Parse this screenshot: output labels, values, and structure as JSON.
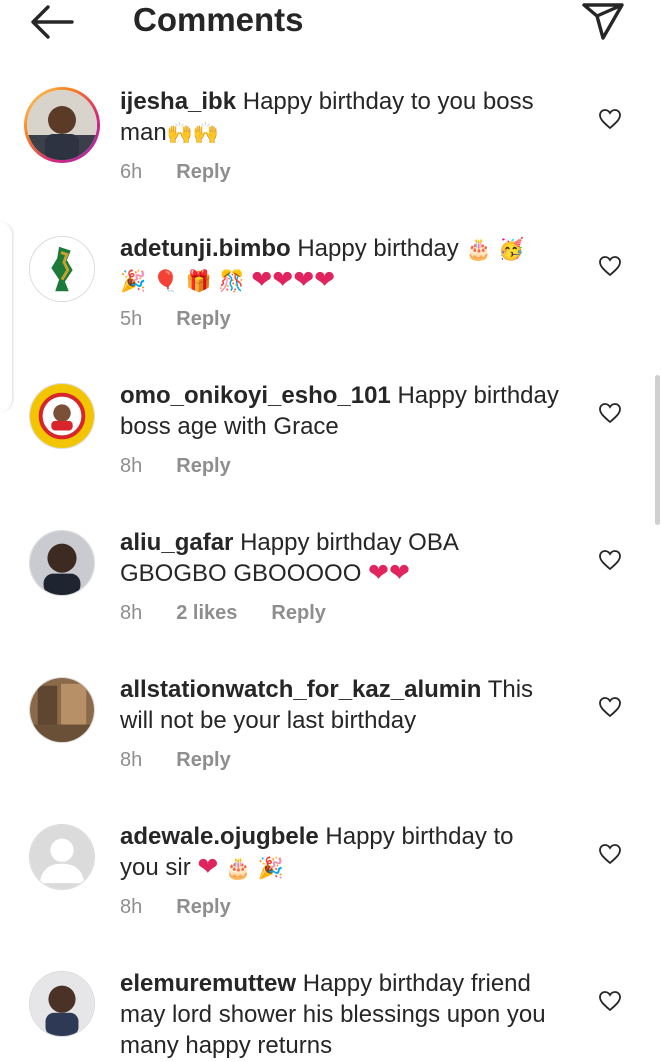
{
  "header": {
    "title": "Comments",
    "back_icon": "arrow-left-icon",
    "share_icon": "paper-plane-icon"
  },
  "comments": [
    {
      "username": "ijesha_ibk",
      "text": "Happy birthday to you boss",
      "text2": "man",
      "emoji": "🙌🙌",
      "time": "6h",
      "reply": "Reply"
    },
    {
      "username": "adetunji.bimbo",
      "text": "Happy birthday",
      "emoji1": "🎂 🥳",
      "emoji2": "🎉 🎈 🎁 🎊",
      "hearts": "❤❤❤❤",
      "time": "5h",
      "reply": "Reply"
    },
    {
      "username": "omo_onikoyi_esho_101",
      "text": "Happy birthday",
      "text2": "boss age with Grace",
      "time": "8h",
      "reply": "Reply"
    },
    {
      "username": "aliu_gafar",
      "text": "Happy birthday OBA",
      "text2": "GBOGBO GBOOOOO",
      "hearts": "❤❤",
      "time": "8h",
      "likes": "2 likes",
      "reply": "Reply"
    },
    {
      "username": "allstationwatch_for_kaz_alumin",
      "text": "This",
      "text2": "will not be your last birthday",
      "time": "8h",
      "reply": "Reply"
    },
    {
      "username": "adewale.ojugbele",
      "text": "Happy birthday to",
      "text2": "you sir",
      "hearts": "❤",
      "emoji": "🎂 🎉",
      "time": "8h",
      "reply": "Reply"
    },
    {
      "username": "elemuremuttew",
      "text": "Happy birthday friend",
      "text2": "may lord shower his blessings upon you",
      "text3": "many happy returns"
    }
  ],
  "colors": {
    "text": "#262626",
    "meta": "#8e8e8e",
    "heart": "#e0245e"
  }
}
